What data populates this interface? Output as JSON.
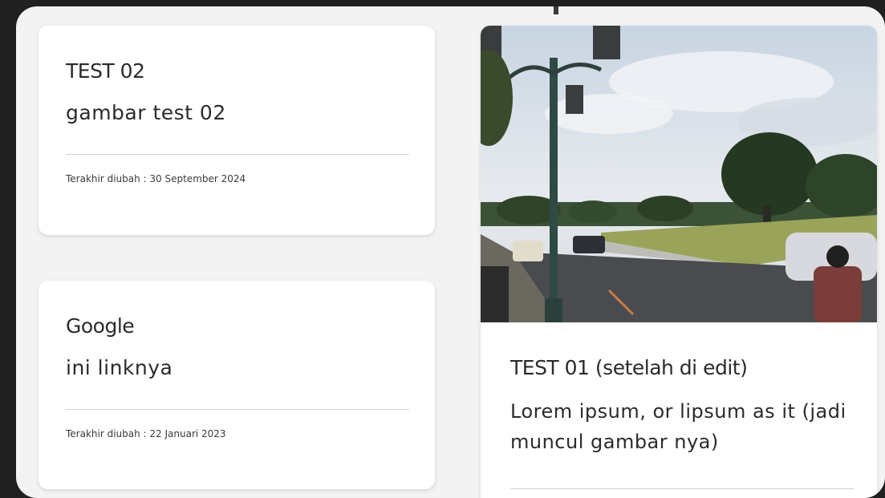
{
  "notes": [
    {
      "title": "TEST 02",
      "body": "gambar test 02",
      "meta": "Terakhir diubah : 30 September 2024"
    },
    {
      "title": "Google",
      "body": "ini linknya",
      "meta": "Terakhir diubah : 22 Januari 2023"
    },
    {
      "title": "TEST 01 (setelah di edit)",
      "body": "Lorem ipsum, or lipsum as it (jadi muncul gambar nya)"
    }
  ],
  "colors": {
    "background": "#202020",
    "frame": "#f3f3f3",
    "card": "#ffffff",
    "text": "#2b2b2b",
    "divider": "#cfcfcf"
  }
}
